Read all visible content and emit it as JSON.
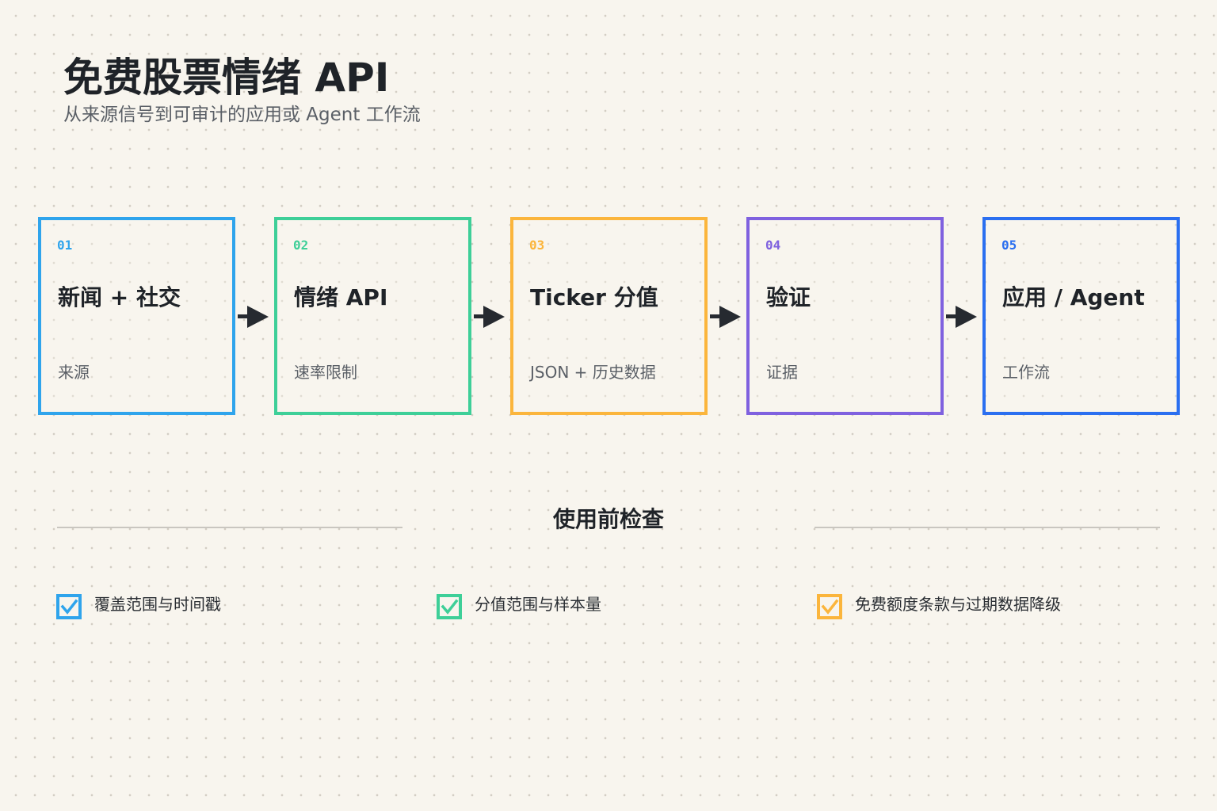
{
  "header": {
    "title": "免费股票情绪 API",
    "subtitle": "从来源信号到可审计的应用或 Agent 工作流"
  },
  "steps": [
    {
      "number": "01",
      "title": "新闻 + 社交",
      "subtitle": "来源",
      "color": "#2fa4ec"
    },
    {
      "number": "02",
      "title": "情绪 API",
      "subtitle": "速率限制",
      "color": "#3ecf98"
    },
    {
      "number": "03",
      "title": "Ticker 分值",
      "subtitle": "JSON + 历史数据",
      "color": "#fbb53c"
    },
    {
      "number": "04",
      "title": "验证",
      "subtitle": "证据",
      "color": "#7f61df"
    },
    {
      "number": "05",
      "title": "应用 / Agent",
      "subtitle": "工作流",
      "color": "#2b6ff0"
    }
  ],
  "arrow_icon": "arrow-right-icon",
  "checklist": {
    "title": "使用前检查",
    "items": [
      {
        "label": "覆盖范围与时间戳",
        "color": "#2fa4ec",
        "checked": true,
        "icon": "checkbox-checked-icon"
      },
      {
        "label": "分值范围与样本量",
        "color": "#3ecf98",
        "checked": true,
        "icon": "checkbox-checked-icon"
      },
      {
        "label": "免费额度条款与过期数据降级",
        "color": "#fbb53c",
        "checked": true,
        "icon": "checkbox-checked-icon"
      }
    ]
  },
  "colors": {
    "background": "#f8f5ee",
    "text": "#1f2328",
    "muted_text": "#5a5f66",
    "arrow": "#262a30",
    "rule": "#c9c6c0"
  }
}
